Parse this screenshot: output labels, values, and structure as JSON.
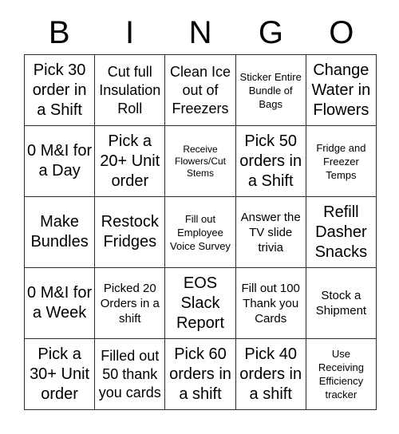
{
  "card": {
    "title": "BINGO",
    "header_letters": [
      "B",
      "I",
      "N",
      "G",
      "O"
    ],
    "columns": 5,
    "rows": 5,
    "border_color": "#2b2b2b",
    "text_color": "#000000",
    "background_color": "#ffffff",
    "cells": [
      {
        "text": "Pick 30 order in a Shift",
        "size": "xl"
      },
      {
        "text": "Cut full Insulation Roll",
        "size": "lg"
      },
      {
        "text": "Clean Ice out of Freezers",
        "size": "lg"
      },
      {
        "text": "Sticker Entire Bundle of Bags",
        "size": "sm"
      },
      {
        "text": "Change Water in Flowers",
        "size": "xl"
      },
      {
        "text": "0 M&I for a Day",
        "size": "xl"
      },
      {
        "text": "Pick a 20+ Unit order",
        "size": "xl"
      },
      {
        "text": "Receive Flowers/Cut Stems",
        "size": "xs"
      },
      {
        "text": "Pick 50 orders in a Shift",
        "size": "xl"
      },
      {
        "text": "Fridge and Freezer Temps",
        "size": "sm"
      },
      {
        "text": "Make Bundles",
        "size": "xl"
      },
      {
        "text": "Restock Fridges",
        "size": "xl"
      },
      {
        "text": "Fill out Employee Voice Survey",
        "size": "sm"
      },
      {
        "text": "Answer the TV slide trivia",
        "size": "md"
      },
      {
        "text": "Refill Dasher Snacks",
        "size": "xl"
      },
      {
        "text": "0 M&I for a Week",
        "size": "xl"
      },
      {
        "text": "Picked 20 Orders in a shift",
        "size": "md"
      },
      {
        "text": "EOS Slack Report",
        "size": "xl"
      },
      {
        "text": "Fill out 100 Thank you Cards",
        "size": "md"
      },
      {
        "text": "Stock a Shipment",
        "size": "md"
      },
      {
        "text": "Pick a 30+ Unit order",
        "size": "xl"
      },
      {
        "text": "Filled out 50 thank you cards",
        "size": "lg"
      },
      {
        "text": "Pick 60 orders in a shift",
        "size": "xl"
      },
      {
        "text": "Pick 40 orders in a shift",
        "size": "xl"
      },
      {
        "text": "Use Receiving Efficiency tracker",
        "size": "sm"
      }
    ]
  }
}
